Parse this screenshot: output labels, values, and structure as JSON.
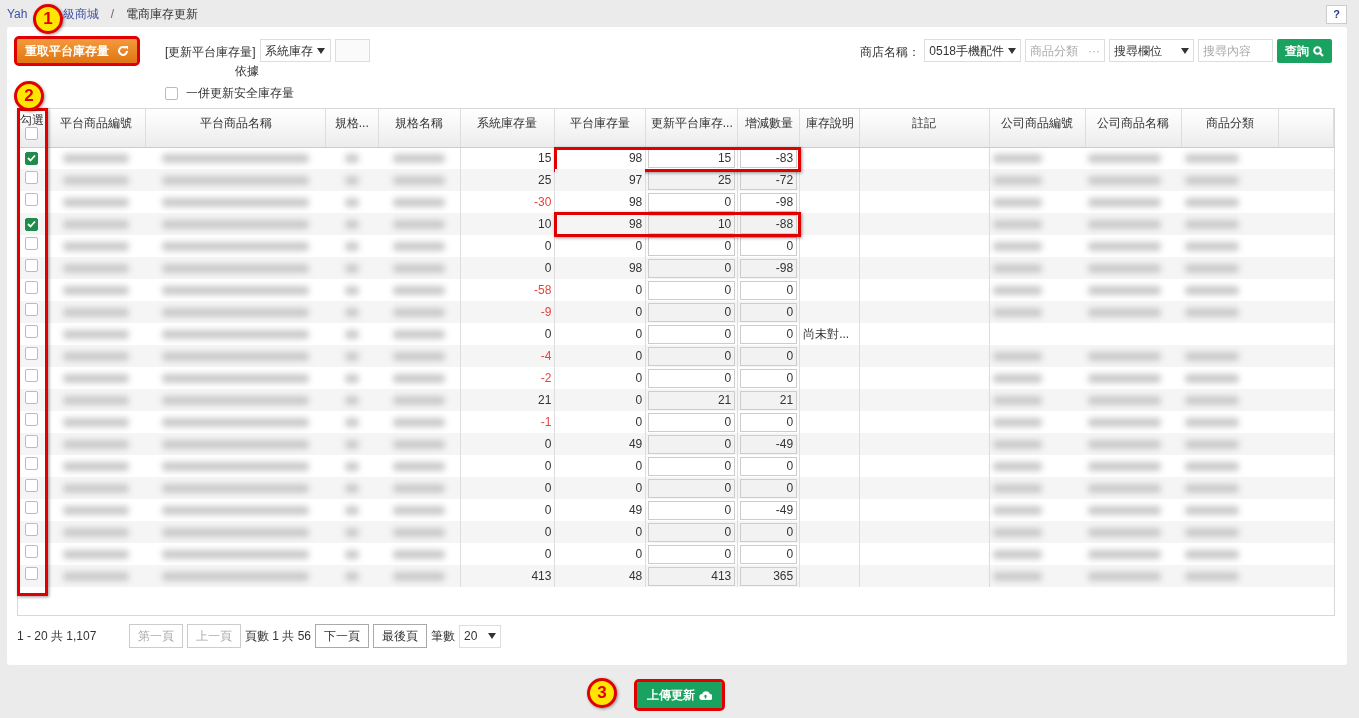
{
  "breadcrumb": {
    "link_parts": [
      "Yah",
      "級商城"
    ],
    "separator": "/",
    "current": "電商庫存更新",
    "callout": "1"
  },
  "help_button": "?",
  "toolbar": {
    "reload_button": {
      "label": "重取平台庫存量",
      "highlighted": true
    },
    "update_label": "[更新平台庫存量]",
    "update_label_2": "依據",
    "basis_select": "系統庫存",
    "safety_checkbox": {
      "label": "一併更新安全庫存量",
      "checked": false
    },
    "callout": "2"
  },
  "filters": {
    "store_label": "商店名稱：",
    "store_select": "0518手機配件",
    "category_placeholder": "商品分類",
    "category_dots": "···",
    "field_select": "搜尋欄位",
    "search_placeholder": "搜尋內容",
    "query_button": "查詢"
  },
  "table": {
    "check_column_highlighted": true,
    "header_checked": false,
    "columns": [
      "勾選",
      "平台商品編號",
      "平台商品名稱",
      "規格...",
      "規格名稱",
      "系統庫存量",
      "平台庫存量",
      "更新平台庫存...",
      "增減數量",
      "庫存說明",
      "註記",
      "公司商品編號",
      "公司商品名稱",
      "商品分類"
    ],
    "rows": [
      {
        "checked": true,
        "system_stock": "15",
        "negative": false,
        "platform_stock": "98",
        "update_value": "15",
        "diff": "-83",
        "mapped": true,
        "highlighted": true
      },
      {
        "checked": false,
        "system_stock": "25",
        "negative": false,
        "platform_stock": "97",
        "update_value": "25",
        "diff": "-72",
        "mapped": true,
        "highlighted": false
      },
      {
        "checked": false,
        "system_stock": "-30",
        "negative": true,
        "platform_stock": "98",
        "update_value": "0",
        "diff": "-98",
        "mapped": true,
        "highlighted": false
      },
      {
        "checked": true,
        "system_stock": "10",
        "negative": false,
        "platform_stock": "98",
        "update_value": "10",
        "diff": "-88",
        "mapped": true,
        "highlighted": true
      },
      {
        "checked": false,
        "system_stock": "0",
        "negative": false,
        "platform_stock": "0",
        "update_value": "0",
        "diff": "0",
        "mapped": true,
        "highlighted": false
      },
      {
        "checked": false,
        "system_stock": "0",
        "negative": false,
        "platform_stock": "98",
        "update_value": "0",
        "diff": "-98",
        "mapped": true,
        "highlighted": false
      },
      {
        "checked": false,
        "system_stock": "-58",
        "negative": true,
        "platform_stock": "0",
        "update_value": "0",
        "diff": "0",
        "mapped": true,
        "highlighted": false
      },
      {
        "checked": false,
        "system_stock": "-9",
        "negative": true,
        "platform_stock": "0",
        "update_value": "0",
        "diff": "0",
        "mapped": true,
        "highlighted": false
      },
      {
        "checked": false,
        "system_stock": "0",
        "negative": false,
        "platform_stock": "0",
        "update_value": "0",
        "diff": "0",
        "note": "尚未對...",
        "mapped": false,
        "highlighted": false
      },
      {
        "checked": false,
        "system_stock": "-4",
        "negative": true,
        "platform_stock": "0",
        "update_value": "0",
        "diff": "0",
        "mapped": true,
        "highlighted": false
      },
      {
        "checked": false,
        "system_stock": "-2",
        "negative": true,
        "platform_stock": "0",
        "update_value": "0",
        "diff": "0",
        "mapped": true,
        "highlighted": false
      },
      {
        "checked": false,
        "system_stock": "21",
        "negative": false,
        "platform_stock": "0",
        "update_value": "21",
        "diff": "21",
        "mapped": true,
        "highlighted": false
      },
      {
        "checked": false,
        "system_stock": "-1",
        "negative": true,
        "platform_stock": "0",
        "update_value": "0",
        "diff": "0",
        "mapped": true,
        "highlighted": false
      },
      {
        "checked": false,
        "system_stock": "0",
        "negative": false,
        "platform_stock": "49",
        "update_value": "0",
        "diff": "-49",
        "mapped": true,
        "highlighted": false
      },
      {
        "checked": false,
        "system_stock": "0",
        "negative": false,
        "platform_stock": "0",
        "update_value": "0",
        "diff": "0",
        "mapped": true,
        "highlighted": false
      },
      {
        "checked": false,
        "system_stock": "0",
        "negative": false,
        "platform_stock": "0",
        "update_value": "0",
        "diff": "0",
        "mapped": true,
        "highlighted": false
      },
      {
        "checked": false,
        "system_stock": "0",
        "negative": false,
        "platform_stock": "49",
        "update_value": "0",
        "diff": "-49",
        "mapped": true,
        "highlighted": false
      },
      {
        "checked": false,
        "system_stock": "0",
        "negative": false,
        "platform_stock": "0",
        "update_value": "0",
        "diff": "0",
        "mapped": true,
        "highlighted": false
      },
      {
        "checked": false,
        "system_stock": "0",
        "negative": false,
        "platform_stock": "0",
        "update_value": "0",
        "diff": "0",
        "mapped": true,
        "highlighted": false
      },
      {
        "checked": false,
        "system_stock": "413",
        "negative": false,
        "platform_stock": "48",
        "update_value": "413",
        "diff": "365",
        "mapped": true,
        "highlighted": false
      }
    ]
  },
  "pagination": {
    "summary": "1 - 20 共 1,107",
    "buttons": [
      {
        "label": "第一頁",
        "disabled": true
      },
      {
        "label": "上一頁",
        "disabled": true
      },
      {
        "label": "下一頁",
        "disabled": false
      },
      {
        "label": "最後頁",
        "disabled": false
      }
    ],
    "page_info": "頁數 1 共 56",
    "size_label": "筆數",
    "size": "20"
  },
  "upload_button": {
    "label": "上傳更新",
    "highlighted": true,
    "callout": "3"
  }
}
